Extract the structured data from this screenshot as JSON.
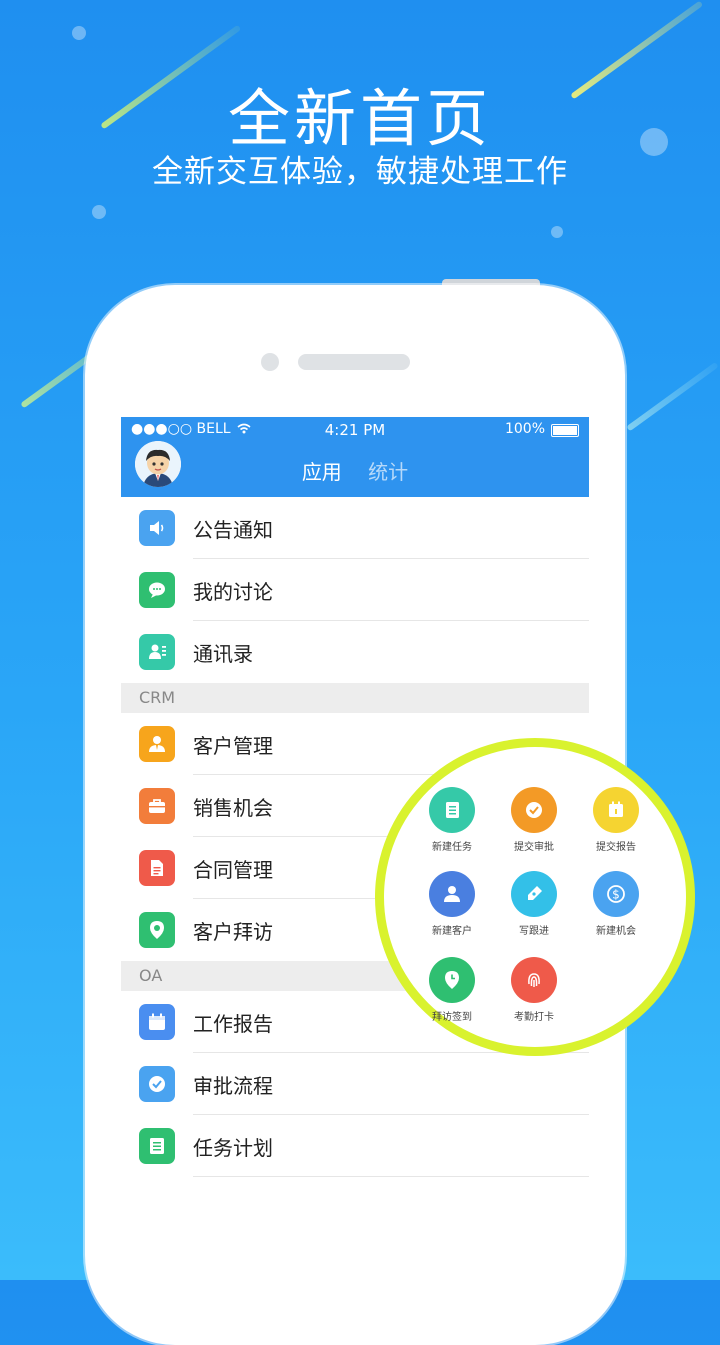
{
  "promo": {
    "headline": "全新首页",
    "subline": "全新交互体验，敏捷处理工作"
  },
  "status_bar": {
    "carrier": "●●●○○ BELL",
    "time": "4:21 PM",
    "battery": "100%"
  },
  "tabs": [
    {
      "label": "应用",
      "active": true
    },
    {
      "label": "统计",
      "active": false
    }
  ],
  "items": [
    {
      "label": "公告通知",
      "icon": "speaker-icon",
      "color": "#4aa3f0"
    },
    {
      "label": "我的讨论",
      "icon": "chat-bubble-icon",
      "color": "#2fbf71"
    },
    {
      "label": "通讯录",
      "icon": "contacts-icon",
      "color": "#35c9a8"
    },
    {
      "label": "客户管理",
      "icon": "customer-icon",
      "color": "#f7a51c"
    },
    {
      "label": "销售机会",
      "icon": "briefcase-icon",
      "color": "#f27d3b"
    },
    {
      "label": "合同管理",
      "icon": "document-icon",
      "color": "#ef5a4a"
    },
    {
      "label": "客户拜访",
      "icon": "location-pin-icon",
      "color": "#2fbf71"
    },
    {
      "label": "工作报告",
      "icon": "calendar-icon",
      "color": "#4a8ef0"
    },
    {
      "label": "审批流程",
      "icon": "check-circle-icon",
      "color": "#4aa3f0"
    },
    {
      "label": "任务计划",
      "icon": "list-icon",
      "color": "#2fbf71"
    }
  ],
  "sections": {
    "crm": "CRM",
    "oa": "OA"
  },
  "quick_actions": [
    {
      "label": "新建任务",
      "icon": "task-icon",
      "color": "#35c9a8"
    },
    {
      "label": "提交审批",
      "icon": "approve-icon",
      "color": "#f39a26"
    },
    {
      "label": "提交报告",
      "icon": "calendar-icon",
      "color": "#f5d431"
    },
    {
      "label": "新建客户",
      "icon": "customer-icon",
      "color": "#4a7fe0"
    },
    {
      "label": "写跟进",
      "icon": "pen-icon",
      "color": "#33c0e8"
    },
    {
      "label": "新建机会",
      "icon": "dollar-icon",
      "color": "#4aa3f0"
    },
    {
      "label": "拜访签到",
      "icon": "clock-pin-icon",
      "color": "#2fbf71"
    },
    {
      "label": "考勤打卡",
      "icon": "fingerprint-icon",
      "color": "#ef5a4a"
    }
  ],
  "pager": {
    "count": 4,
    "active": 0
  }
}
